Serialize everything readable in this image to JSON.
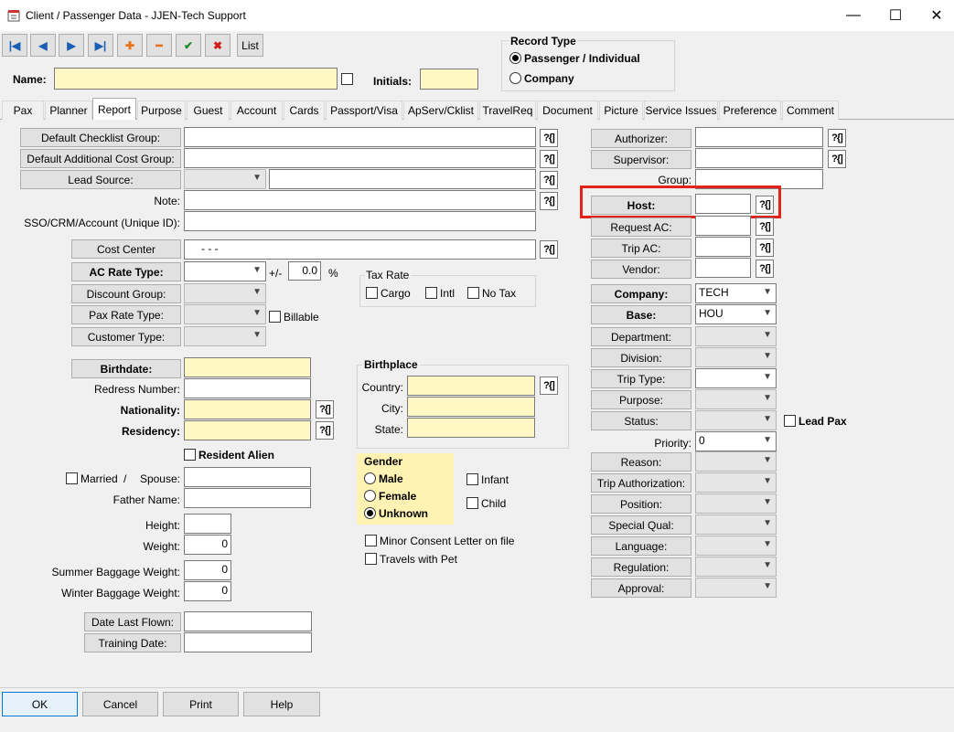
{
  "window": {
    "title": "Client / Passenger Data - JJEN-Tech Support"
  },
  "toolbar": {
    "first": "|◀",
    "prev": "◀",
    "next": "▶",
    "last": "▶|",
    "add": "✚",
    "remove": "━",
    "confirm": "✔",
    "cancel": "✖",
    "list": "List"
  },
  "header": {
    "name_label": "Name:",
    "initials_label": "Initials:"
  },
  "record_type": {
    "title": "Record Type",
    "passenger": "Passenger / Individual",
    "company": "Company"
  },
  "tabs": [
    "Pax",
    "Planner",
    "Report",
    "Purpose",
    "Guest",
    "Account",
    "Cards",
    "Passport/Visa",
    "ApServ/Cklist",
    "TravelReq",
    "Document",
    "Picture",
    "Service Issues",
    "Preference",
    "Comment"
  ],
  "qmark": "?{]",
  "left": {
    "default_checklist": "Default Checklist Group:",
    "default_additional": "Default Additional Cost Group:",
    "lead_source": "Lead Source:",
    "note": "Note:",
    "sso": "SSO/CRM/Account (Unique ID):",
    "cost_center": "Cost Center",
    "cost_center_value": "-      -    -",
    "ac_rate_type": "AC Rate Type:",
    "plusminus": "+/-",
    "rate_value": "0.0",
    "percent": "%",
    "discount_group": "Discount Group:",
    "pax_rate_type": "Pax Rate Type:",
    "billable": "Billable",
    "customer_type": "Customer Type:",
    "birthdate": "Birthdate:",
    "redress": "Redress Number:",
    "nationality": "Nationality:",
    "residency": "Residency:",
    "resident_alien": "Resident Alien",
    "married": "Married",
    "slash": "/",
    "spouse": "Spouse:",
    "father": "Father Name:",
    "height": "Height:",
    "weight": "Weight:",
    "weight_value": "0",
    "summer_bag": "Summer Baggage Weight:",
    "summer_value": "0",
    "winter_bag": "Winter Baggage Weight:",
    "winter_value": "0",
    "date_last_flown": "Date Last Flown:",
    "training_date": "Training Date:"
  },
  "tax_rate": {
    "title": "Tax Rate",
    "cargo": "Cargo",
    "intl": "Intl",
    "no_tax": "No Tax"
  },
  "birthplace": {
    "title": "Birthplace",
    "country": "Country:",
    "city": "City:",
    "state": "State:"
  },
  "gender": {
    "title": "Gender",
    "male": "Male",
    "female": "Female",
    "unknown": "Unknown",
    "infant": "Infant",
    "child": "Child"
  },
  "misc": {
    "minor_consent": "Minor Consent Letter on file",
    "travels_pet": "Travels with Pet"
  },
  "right": {
    "authorizer": "Authorizer:",
    "supervisor": "Supervisor:",
    "group": "Group:",
    "host": "Host:",
    "request_ac": "Request AC:",
    "trip_ac": "Trip AC:",
    "vendor": "Vendor:",
    "company": "Company:",
    "company_value": "TECH",
    "base": "Base:",
    "base_value": "HOU",
    "department": "Department:",
    "division": "Division:",
    "trip_type": "Trip Type:",
    "purpose": "Purpose:",
    "status": "Status:",
    "lead_pax": "Lead Pax",
    "priority": "Priority:",
    "priority_value": "0",
    "reason": "Reason:",
    "trip_authorization": "Trip Authorization:",
    "position": "Position:",
    "special_qual": "Special Qual:",
    "language": "Language:",
    "regulation": "Regulation:",
    "approval": "Approval:"
  },
  "footer": {
    "ok": "OK",
    "cancel": "Cancel",
    "print": "Print",
    "help": "Help"
  },
  "colors": {
    "highlight": "#e2231a",
    "required": "#fff7c4",
    "gender_bg": "#fff2b3"
  }
}
